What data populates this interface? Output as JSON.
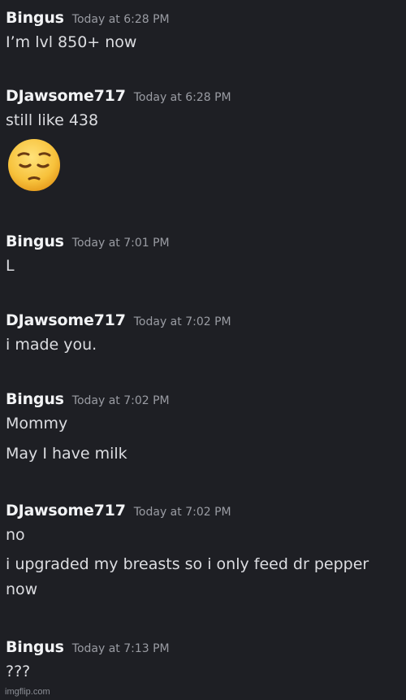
{
  "messages": [
    {
      "author": "Bingus",
      "timestamp": "Today at 6:28 PM",
      "lines": [
        "I’m lvl 850+ now"
      ]
    },
    {
      "author": "DJawsome717",
      "timestamp": "Today at 6:28 PM",
      "lines": [
        "still like 438"
      ],
      "emoji": "pensive-face"
    },
    {
      "author": "Bingus",
      "timestamp": "Today at 7:01 PM",
      "lines": [
        "L"
      ]
    },
    {
      "author": "DJawsome717",
      "timestamp": "Today at 7:02 PM",
      "lines": [
        "i made you."
      ]
    },
    {
      "author": "Bingus",
      "timestamp": "Today at 7:02 PM",
      "lines": [
        "Mommy",
        "May I have milk"
      ]
    },
    {
      "author": "DJawsome717",
      "timestamp": "Today at 7:02 PM",
      "lines": [
        "no",
        "i upgraded my breasts so i only feed dr pepper now"
      ]
    },
    {
      "author": "Bingus",
      "timestamp": "Today at 7:13 PM",
      "lines": [
        "???"
      ]
    }
  ],
  "watermark": "imgflip.com",
  "colors": {
    "background": "#1e1f24",
    "author": "#f2f3f5",
    "timestamp": "#9a9ca3",
    "text": "#dcdde1",
    "emoji": "#f7c23c"
  }
}
